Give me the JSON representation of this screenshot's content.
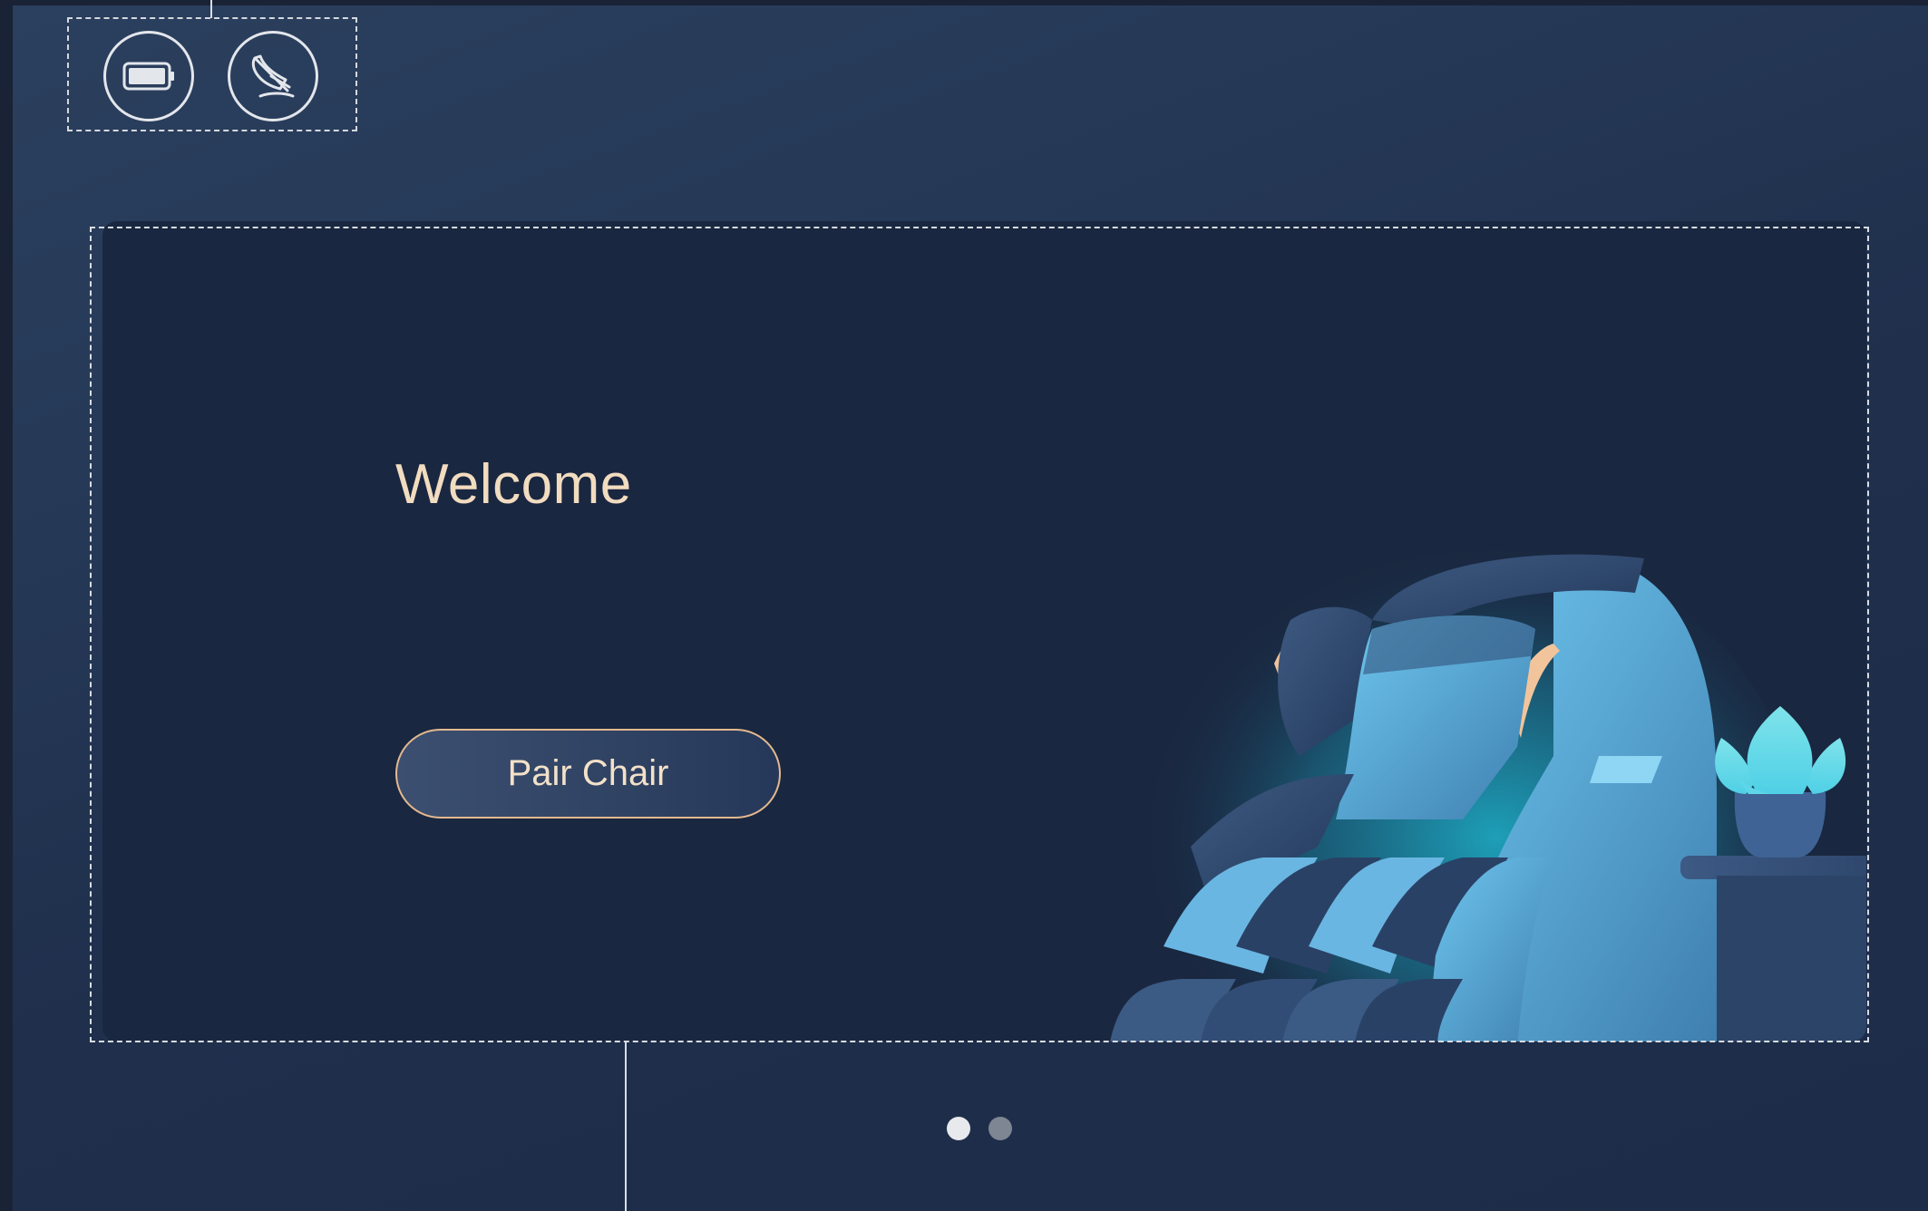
{
  "welcome": {
    "heading": "Welcome",
    "pair_button_label": "Pair Chair"
  },
  "status_bar": {
    "icons": [
      "battery-icon",
      "satellite-dish-icon"
    ]
  },
  "carousel": {
    "page_count": 2,
    "active_index": 0
  },
  "colors": {
    "accent_text": "#f2dcc0",
    "button_border": "#e3b98f",
    "card_background": "#1a2740",
    "illustration_glow": "#1fc7e0"
  }
}
